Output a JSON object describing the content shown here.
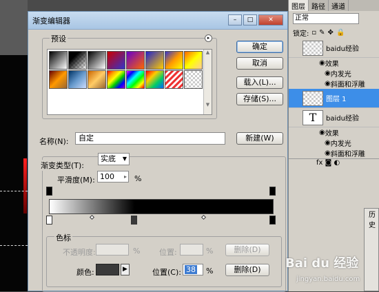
{
  "dialog": {
    "title": "渐变编辑器",
    "presets_label": "预设",
    "buttons": {
      "ok": "确定",
      "cancel": "取消",
      "load": "载入(L)...",
      "save": "存储(S)...",
      "new": "新建(W)"
    },
    "name_label": "名称(N):",
    "name_value": "自定",
    "gradient_type_label": "渐变类型(T):",
    "gradient_type_value": "实底",
    "smoothness_label": "平滑度(M):",
    "smoothness_value": "100",
    "smoothness_unit": "%",
    "color_stops_label": "色标",
    "opacity_label": "不透明度:",
    "opacity_unit": "%",
    "location_label_top": "位置:",
    "location_unit_top": "%",
    "delete_label_top": "删除(D)",
    "color_label": "颜色:",
    "location_label": "位置(C):",
    "location_value": "38",
    "location_unit": "%",
    "delete_label": "删除(D)",
    "selected_stop_location_percent": 38,
    "stop_color": "#3a3a3a"
  },
  "layers_panel": {
    "tabs": [
      "图层",
      "路径",
      "通道"
    ],
    "blend_mode": "正常",
    "lock_label": "锁定:",
    "layers": [
      {
        "name": "baidu经验",
        "kind": "text-mask"
      },
      {
        "name": "图层 1",
        "kind": "pixel",
        "selected": true
      },
      {
        "name": "baidu经验",
        "kind": "text"
      }
    ],
    "effects_label": "效果",
    "inner_glow": "内发光",
    "bevel": "斜面和浮雕",
    "history_tab": "历史"
  },
  "watermark": {
    "brand": "Bai du 经验",
    "url": "jingyan.baidu.com"
  }
}
